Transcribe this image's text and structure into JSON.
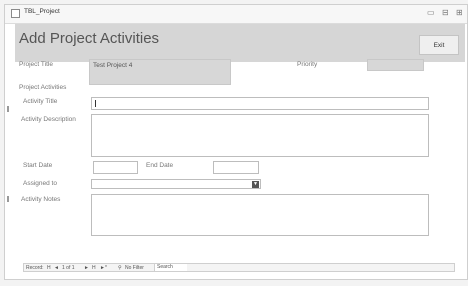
{
  "window": {
    "title": "TBL_Project",
    "controls": [
      "▭",
      "⊟",
      "⊞"
    ]
  },
  "header": {
    "title": "Add Project Activities",
    "exit_label": "Exit"
  },
  "project": {
    "title_label": "Project Title",
    "title_value": "Test Project 4",
    "priority_label": "Priority",
    "priority_value": ""
  },
  "activities": {
    "section_label": "Project Activities",
    "activity_title_label": "Activity Title",
    "activity_title_value": "",
    "activity_description_label": "Activity Description",
    "activity_description_value": "",
    "start_date_label": "Start Date",
    "start_date_value": "",
    "end_date_label": "End Date",
    "end_date_value": "",
    "assigned_to_label": "Assigned to",
    "assigned_to_value": "",
    "activity_notes_label": "Activity Notes",
    "activity_notes_value": ""
  },
  "navigation": {
    "record_label": "Record:",
    "first": "H",
    "prev": "◄",
    "position": "1 of 1",
    "next": "►",
    "last": "H",
    "new": "►*",
    "filter": "No Filter",
    "search": "Search"
  }
}
